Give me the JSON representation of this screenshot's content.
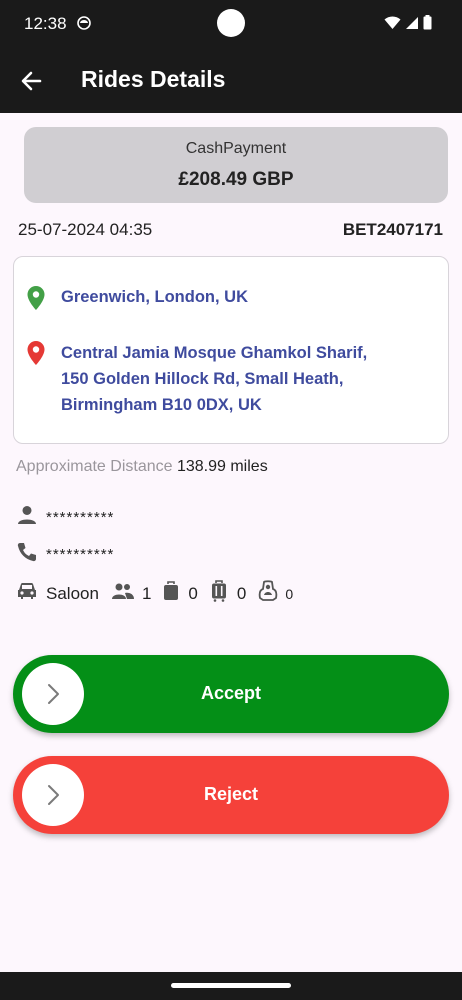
{
  "status": {
    "time": "12:38"
  },
  "header": {
    "title": "Rides Details"
  },
  "payment": {
    "type": "CashPayment",
    "amount": "£208.49 GBP"
  },
  "ride": {
    "datetime": "25-07-2024 04:35",
    "reference": "BET2407171"
  },
  "addresses": {
    "pickup": "Greenwich, London, UK",
    "dropoff_line1": "Central Jamia Mosque Ghamkol Sharif,",
    "dropoff_line2": "150 Golden Hillock Rd, Small Heath,",
    "dropoff_line3": "Birmingham B10 0DX, UK"
  },
  "distance": {
    "label": "Approximate Distance",
    "value": "138.99 miles"
  },
  "passenger": {
    "name": "**********",
    "phone": "**********"
  },
  "vehicle": {
    "type": "Saloon",
    "passengers": "1",
    "hand_luggage": "0",
    "suitcases": "0",
    "child_seats": "0"
  },
  "actions": {
    "accept_label": "Accept",
    "reject_label": "Reject"
  },
  "colors": {
    "accept": "#048f17",
    "reject": "#f5413a",
    "address_text": "#3f4b9e",
    "pickup_pin": "#43a047",
    "drop_pin": "#e53935"
  }
}
